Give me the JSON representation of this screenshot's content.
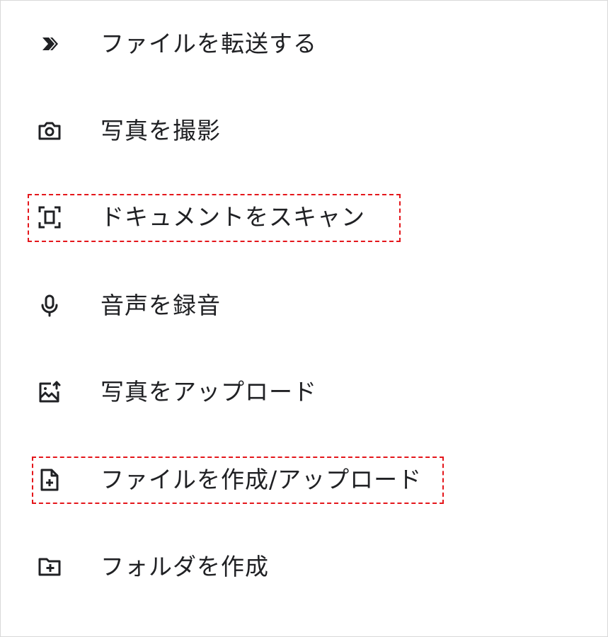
{
  "menu": {
    "items": [
      {
        "label": "ファイルを転送する",
        "icon": "transfer-icon"
      },
      {
        "label": "写真を撮影",
        "icon": "camera-icon"
      },
      {
        "label": "ドキュメントをスキャン",
        "icon": "document-scanner-icon"
      },
      {
        "label": "音声を録音",
        "icon": "microphone-icon"
      },
      {
        "label": "写真をアップロード",
        "icon": "photo-upload-icon"
      },
      {
        "label": "ファイルを作成/アップロード",
        "icon": "file-add-icon"
      },
      {
        "label": "フォルダを作成",
        "icon": "folder-add-icon"
      }
    ]
  },
  "colors": {
    "text": "#202124",
    "icon": "#202124",
    "highlight": "#e4161b"
  }
}
